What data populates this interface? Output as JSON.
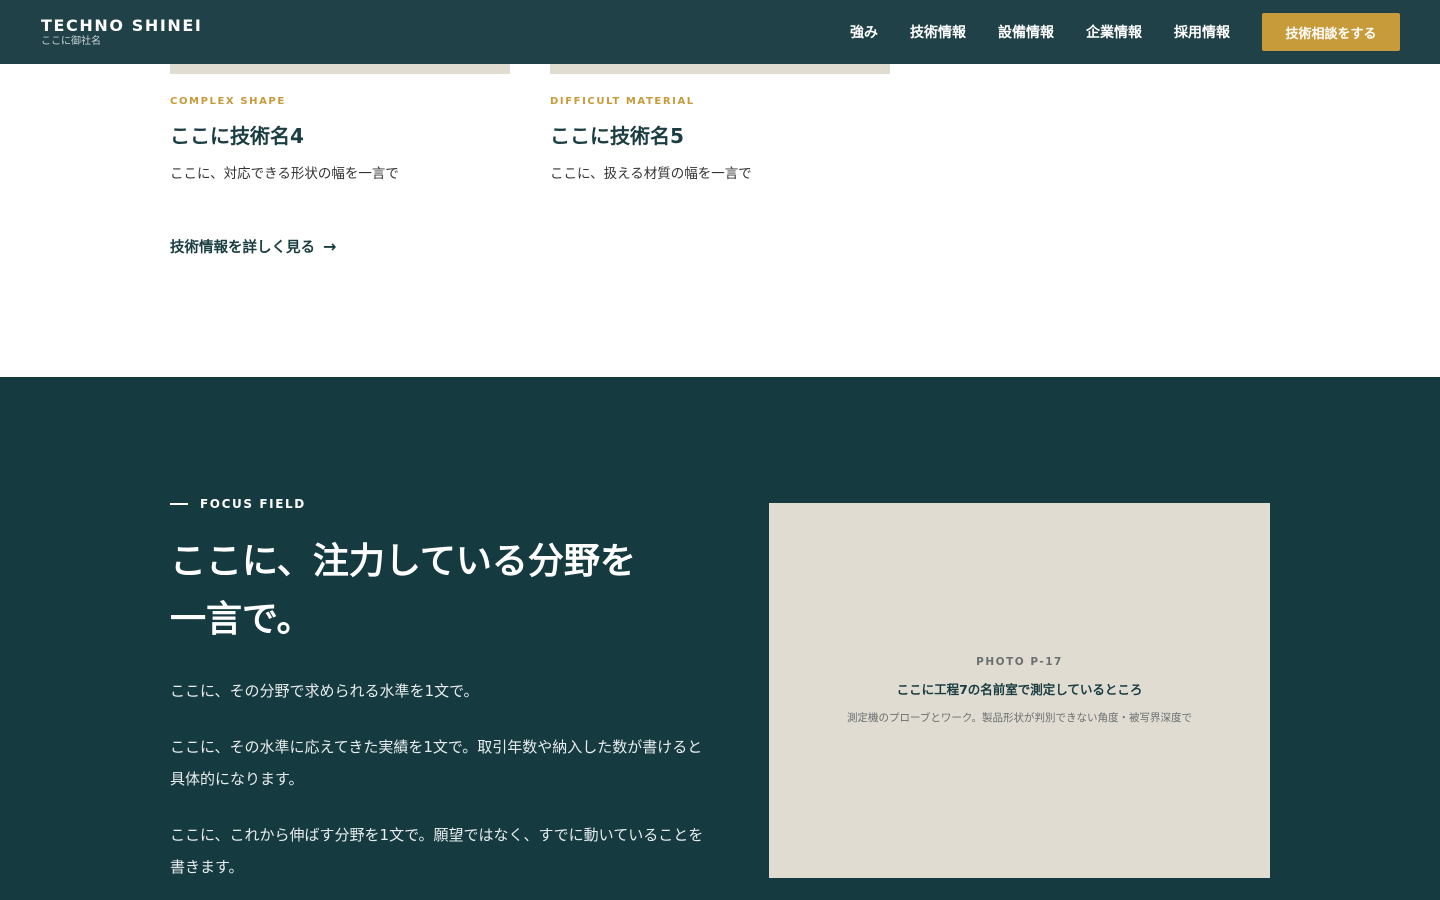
{
  "header": {
    "brand_name": "TECHNO SHINEI",
    "brand_sub": "ここに御社名",
    "nav": [
      "強み",
      "技術情報",
      "設備情報",
      "企業情報",
      "採用情報"
    ],
    "cta_label": "技術相談をする"
  },
  "tech_cards": [
    {
      "tag": "COMPLEX SHAPE",
      "title": "ここに技術名4",
      "desc": "ここに、対応できる形状の幅を一言で"
    },
    {
      "tag": "DIFFICULT MATERIAL",
      "title": "ここに技術名5",
      "desc": "ここに、扱える材質の幅を一言で"
    }
  ],
  "tech_more": {
    "label": "技術情報を詳しく見る",
    "arrow": "→"
  },
  "focus": {
    "label": "FOCUS FIELD",
    "title_line1": "ここに、注力している分野を",
    "title_line2": "一言で。",
    "paragraphs": [
      "ここに、その分野で求められる水準を1文で。",
      "ここに、その水準に応えてきた実績を1文で。取引年数や納入した数が書けると具体的になります。",
      "ここに、これから伸ばす分野を1文で。願望ではなく、すでに動いていることを書きます。"
    ],
    "photo": {
      "code": "PHOTO P-17",
      "title": "ここに工程7の名前室で測定しているところ",
      "desc": "測定機のプローブとワーク。製品形状が判別できない角度・被写界深度で"
    }
  }
}
